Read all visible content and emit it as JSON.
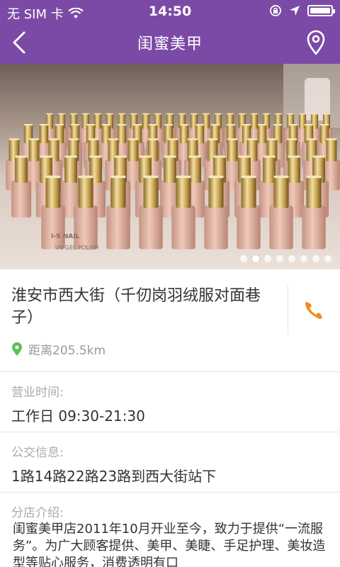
{
  "status_bar": {
    "carrier": "无 SIM 卡",
    "time": "14:50"
  },
  "header": {
    "title": "闺蜜美甲"
  },
  "banner": {
    "brand_text": "I-S NAIL",
    "product_text": "UV GEL POLISH",
    "slide_count": 8,
    "active_slide": 2
  },
  "shop": {
    "address": "淮安市西大街（千仞岗羽绒服对面巷子）",
    "distance": "距离205.5km"
  },
  "hours": {
    "label": "营业时间:",
    "value": "工作日 09:30-21:30"
  },
  "transit": {
    "label": "公交信息:",
    "value": "1路14路22路23路到西大街站下"
  },
  "intro": {
    "label": "分店介绍:",
    "text": "闺蜜美甲店2011年10月开业至今，致力于提供“一流服务”。为广大顾客提供、美甲、美睫、手足护理、美妆造型等贴心服务，消费透明有口"
  },
  "colors": {
    "brand_purple": "#7b4aa6",
    "phone_orange": "#f08a1c",
    "pin_green": "#5cbf5a"
  }
}
